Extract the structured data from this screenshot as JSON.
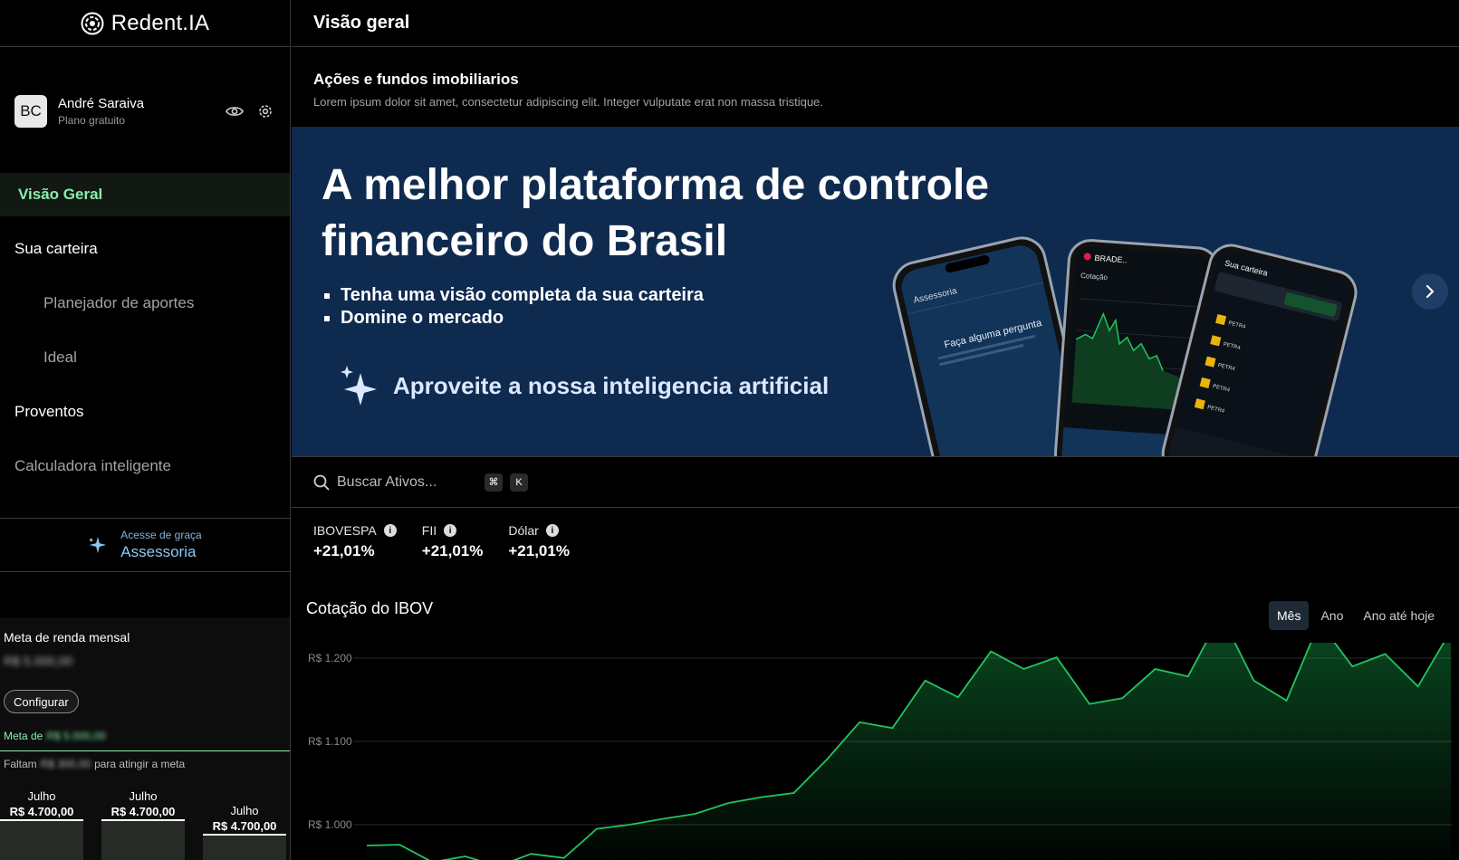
{
  "brand": {
    "name": "Redent.IA"
  },
  "profile": {
    "initials": "BC",
    "name": "André Saraiva",
    "plan": "Plano gratuito"
  },
  "nav": {
    "visao_geral": "Visão Geral",
    "sua_carteira": "Sua carteira",
    "planejador": "Planejador de aportes",
    "ideal": "Ideal",
    "proventos": "Proventos",
    "calculadora": "Calculadora inteligente"
  },
  "assessoria": {
    "small": "Acesse de graça",
    "big": "Assessoria"
  },
  "goal": {
    "title": "Meta de renda mensal",
    "value": "R$ 5.000,00",
    "configure": "Configurar",
    "meta_prefix": "Meta de",
    "meta_value": "R$ 5.000,00",
    "faltam_prefix": "Faltam",
    "faltam_value": "R$ 300,00",
    "faltam_suffix": "para atingir a meta",
    "months": [
      {
        "name": "Julho",
        "value": "R$ 4.700,00"
      },
      {
        "name": "Julho",
        "value": "R$ 4.700,00"
      },
      {
        "name": "Julho",
        "value": "R$ 4.700,00"
      }
    ]
  },
  "header": {
    "title": "Visão geral"
  },
  "section": {
    "title": "Ações e fundos imobiliarios",
    "description": "Lorem ipsum dolor sit amet, consectetur adipiscing elit. Integer vulputate erat non massa tristique."
  },
  "banner": {
    "title": "A melhor plataforma de controle financeiro do Brasil",
    "bullets": [
      "Tenha uma visão completa da sua carteira",
      "Domine o mercado"
    ],
    "ai_text": "Aproveite a nossa inteligencia artificial",
    "phone_labels": {
      "p1_header": "Assessoria",
      "p1_prompt": "Faça alguma pergunta",
      "p2_header": "BRADE..",
      "p2_sub": "Cotação",
      "p3_header": "Sua carteira",
      "ticker": "PETR4"
    }
  },
  "search": {
    "placeholder": "Buscar Ativos...",
    "key1": "⌘",
    "key2": "K"
  },
  "indices": [
    {
      "label": "IBOVESPA",
      "value": "+21,01%"
    },
    {
      "label": "FII",
      "value": "+21,01%"
    },
    {
      "label": "Dólar",
      "value": "+21,01%"
    }
  ],
  "chart_title": "Cotação do IBOV",
  "range_tabs": [
    "Mês",
    "Ano",
    "Ano até hoje"
  ],
  "colors": {
    "accent_green": "#86efac",
    "line_green": "#22c55e",
    "banner_bg": "#0f2a4f",
    "assess_blue": "#8cc8f5"
  },
  "chart_data": {
    "type": "area",
    "title": "Cotação do IBOV",
    "ylim": [
      940,
      1240
    ],
    "yticks": [
      "R$ 1.200",
      "R$ 1.100",
      "R$ 1.000"
    ],
    "ytick_values": [
      1200,
      1100,
      1000
    ],
    "grid": true,
    "values": [
      975,
      976,
      955,
      962,
      950,
      965,
      960,
      995,
      1000,
      1007,
      1013,
      1026,
      1033,
      1038,
      1078,
      1123,
      1116,
      1173,
      1153,
      1208,
      1187,
      1201,
      1145,
      1152,
      1187,
      1178,
      1252,
      1173,
      1149,
      1243,
      1190,
      1205,
      1166,
      1233
    ]
  }
}
